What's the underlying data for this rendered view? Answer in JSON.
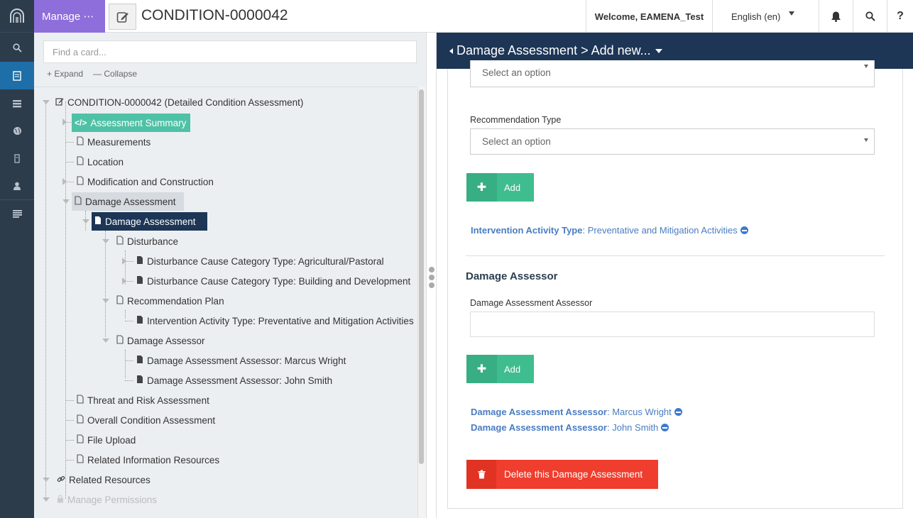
{
  "header": {
    "manage_label": "Manage ⋯",
    "resource_title": "CONDITION-0000042",
    "welcome": "Welcome, EAMENA_Test",
    "language": "English (en)"
  },
  "tree_panel": {
    "search_placeholder": "Find a card...",
    "expand_label": "Expand",
    "collapse_label": "Collapse",
    "nodes": [
      "CONDITION-0000042 (Detailed Condition Assessment)",
      "Assessment Summary",
      "Measurements",
      "Location",
      "Modification and Construction",
      "Damage Assessment",
      "Damage Assessment",
      "Disturbance",
      "Disturbance Cause Category Type: Agricultural/Pastoral",
      "Disturbance Cause Category Type: Building and Development",
      "Recommendation Plan",
      "Intervention Activity Type: Preventative and Mitigation Activities",
      "Damage Assessor",
      "Damage Assessment Assessor: Marcus Wright",
      "Damage Assessment Assessor: John Smith",
      "Threat and Risk Assessment",
      "Overall Condition Assessment",
      "File Upload",
      "Related Information Resources",
      "Related Resources",
      "Manage Permissions"
    ]
  },
  "form": {
    "breadcrumb": "Damage Assessment > Add new...",
    "top_select_placeholder": "Select an option",
    "recommendation_type_label": "Recommendation Type",
    "recommendation_type_placeholder": "Select an option",
    "add_label": "Add",
    "intervention_key": "Intervention Activity Type",
    "intervention_value": "Preventative and Mitigation Activities",
    "damage_assessor_title": "Damage Assessor",
    "damage_assessor_field_label": "Damage Assessment Assessor",
    "assessors": [
      {
        "key": "Damage Assessment Assessor",
        "value": "Marcus Wright"
      },
      {
        "key": "Damage Assessment Assessor",
        "value": "John Smith"
      }
    ],
    "delete_label": "Delete this Damage Assessment"
  }
}
